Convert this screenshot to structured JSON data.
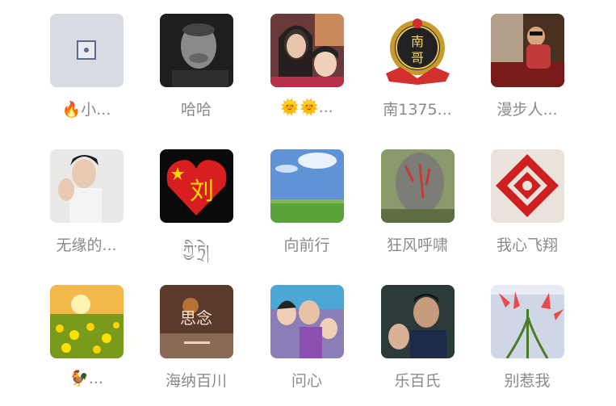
{
  "friends": [
    {
      "name": "🔥小...",
      "avatar": "placeholder-avatar"
    },
    {
      "name": "哈哈",
      "avatar": "bw-portrait-avatar"
    },
    {
      "name": "🌞🌞...",
      "avatar": "mother-daughter-selfie-avatar"
    },
    {
      "name": "南1375...",
      "avatar": "badge-avatar"
    },
    {
      "name": "漫步人...",
      "avatar": "child-photo-avatar"
    },
    {
      "name": "无缘的...",
      "avatar": "man-portrait-avatar"
    },
    {
      "name": "ཀྱི་ཏྲེ།",
      "avatar": "flag-heart-avatar"
    },
    {
      "name": "向前行",
      "avatar": "sky-field-avatar"
    },
    {
      "name": "狂风呼啸",
      "avatar": "stone-calligraphy-avatar"
    },
    {
      "name": "我心飞翔",
      "avatar": "paper-cut-avatar"
    },
    {
      "name": "🐓...",
      "avatar": "sunflower-field-avatar"
    },
    {
      "name": "海纳百川",
      "avatar": "calligraphy-avatar"
    },
    {
      "name": "问心",
      "avatar": "family-photo-avatar"
    },
    {
      "name": "乐百氏",
      "avatar": "couple-photo-avatar"
    },
    {
      "name": "别惹我",
      "avatar": "red-flower-avatar"
    }
  ],
  "badge_text": "南\n哥",
  "calligraphy_text": "思念"
}
